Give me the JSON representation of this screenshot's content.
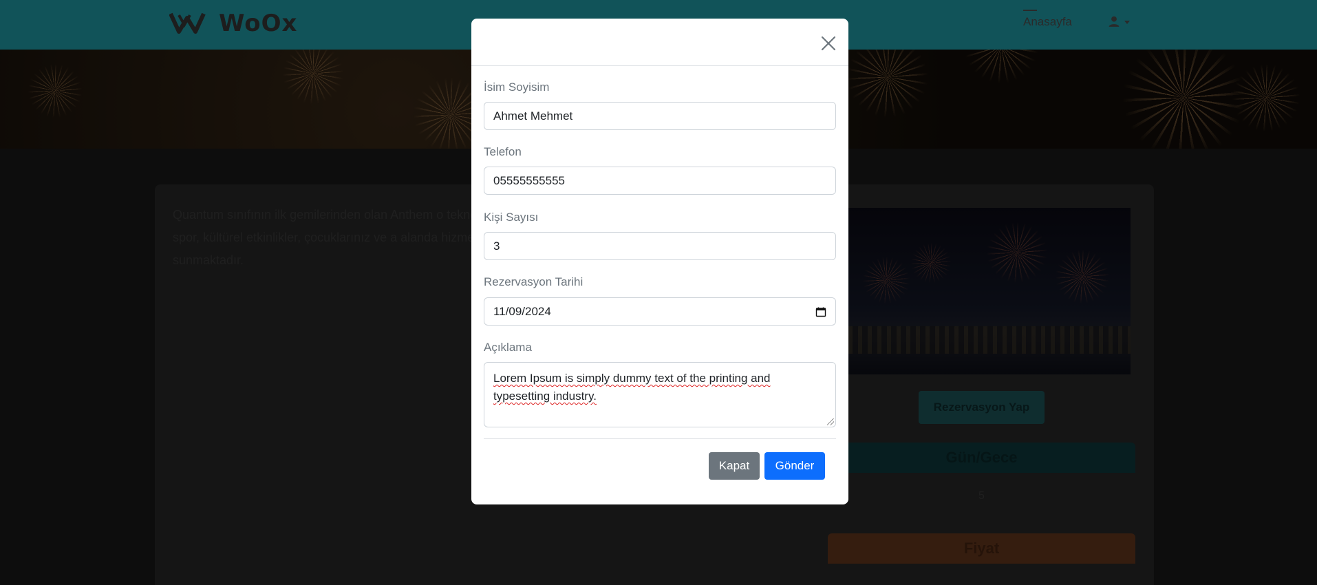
{
  "navbar": {
    "brand": "WoOx",
    "home_label": "Anasayfa",
    "user_icon": "user-icon"
  },
  "page": {
    "description": "Quantum sınıfının ilk gemilerinden olan Anthem o teknoloji, spor, kültürel etkinlikler, çocuklarınız ve a alanda hizmetler sunmaktadır.",
    "reserve_button": "Rezervasyon Yap",
    "day_night_label": "Gün/Gece",
    "day_night_value": "5",
    "price_label": "Fiyat"
  },
  "modal": {
    "close_icon": "close-icon",
    "fields": {
      "name": {
        "label": "İsim Soyisim",
        "value": "Ahmet Mehmet"
      },
      "phone": {
        "label": "Telefon",
        "value": "05555555555"
      },
      "people": {
        "label": "Kişi Sayısı",
        "value": "3"
      },
      "date": {
        "label": "Rezervasyon Tarihi",
        "value": "11/09/2024"
      },
      "note": {
        "label": "Açıklama",
        "value": "Lorem Ipsum is simply dummy text of the printing and typesetting industry."
      }
    },
    "buttons": {
      "close": "Kapat",
      "send": "Gönder"
    }
  },
  "colors": {
    "primary": "#0d6efd",
    "secondary": "#6c757d",
    "navbar": "#22a6b3"
  }
}
